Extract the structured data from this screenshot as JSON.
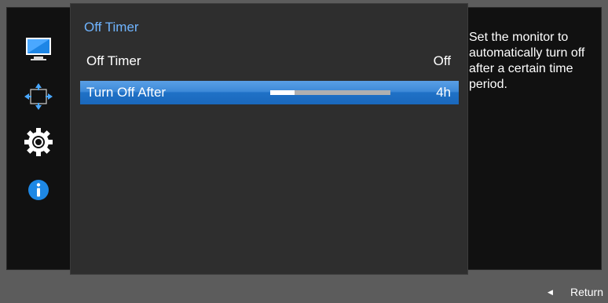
{
  "menu": {
    "title": "Off Timer",
    "items": [
      {
        "label": "Off Timer",
        "value": "Off",
        "selected": false
      },
      {
        "label": "Turn Off After",
        "value": "4h",
        "selected": true,
        "slider_level": 0.2
      }
    ]
  },
  "sidebar": {
    "icons": [
      "monitor-icon",
      "arrows-icon",
      "gear-icon",
      "info-icon"
    ]
  },
  "help": {
    "text": "Set the monitor to automatically turn off after a certain time period."
  },
  "footer": {
    "return_label": "Return",
    "return_icon": "left-triangle-icon"
  },
  "colors": {
    "title_blue": "#6fb4ff",
    "selection_blue": "#1f71c6",
    "info_blue": "#1e88e5"
  }
}
